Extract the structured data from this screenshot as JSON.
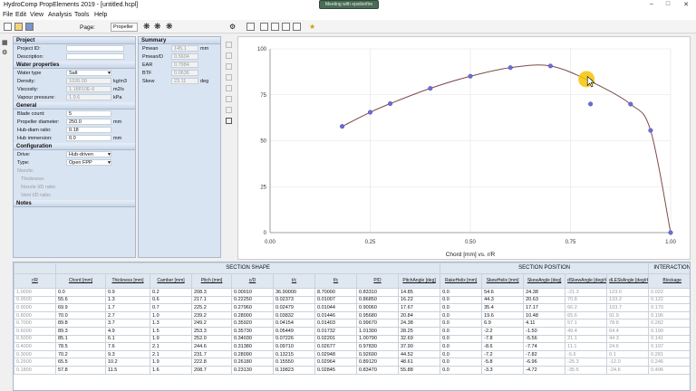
{
  "window": {
    "title": "HydroComp PropElements 2019 - [untitled.hcpl]",
    "notification": "Meeting with epsilonfire"
  },
  "menu": [
    "File",
    "Edit",
    "View",
    "Analysis",
    "Tools",
    "Help"
  ],
  "toolbar": {
    "page_label": "Page:",
    "page_value": "Propeller"
  },
  "project": {
    "heading": "Project",
    "fields": [
      {
        "label": "Project ID:",
        "value": ""
      },
      {
        "label": "Description:",
        "value": ""
      }
    ]
  },
  "water": {
    "heading": "Water properties",
    "fields": [
      {
        "label": "Water type",
        "value": "Salt",
        "unit": ""
      },
      {
        "label": "Density:",
        "value": "1026.00",
        "unit": "kg/m3"
      },
      {
        "label": "Viscosity:",
        "value": "1.18810E-6",
        "unit": "m2/s"
      },
      {
        "label": "Vapour pressure:",
        "value": "1.9.6",
        "unit": "kPa"
      }
    ]
  },
  "general": {
    "heading": "General",
    "fields": [
      {
        "label": "Blade count:",
        "value": "5",
        "unit": ""
      },
      {
        "label": "Propeller diameter:",
        "value": "250.0",
        "unit": "mm"
      },
      {
        "label": "Hub-diam ratio:",
        "value": "0.18",
        "unit": ""
      },
      {
        "label": "Hub immersion:",
        "value": "0.0",
        "unit": "mm"
      }
    ]
  },
  "configuration": {
    "heading": "Configuration",
    "fields": [
      {
        "label": "Drive:",
        "value": "Hub-driven"
      },
      {
        "label": "Type:",
        "value": "Open FPP"
      },
      {
        "label": "Nozzle:",
        "value": ""
      },
      {
        "label": "Thickness:",
        "value": ""
      },
      {
        "label": "Nozzle I/D ratio:",
        "value": ""
      },
      {
        "label": "Vent I/D ratio:",
        "value": ""
      }
    ]
  },
  "notes": {
    "heading": "Notes"
  },
  "summary": {
    "heading": "Summary",
    "fields": [
      {
        "label": "Pmean",
        "value": "145.1",
        "unit": "mm"
      },
      {
        "label": "Pmean/D",
        "value": "0.5604",
        "unit": ""
      },
      {
        "label": "EAR",
        "value": "0.7984",
        "unit": ""
      },
      {
        "label": "BTF",
        "value": "0.0636",
        "unit": ""
      },
      {
        "label": "Skew",
        "value": "23.11",
        "unit": "deg"
      }
    ]
  },
  "chart_data": {
    "type": "line",
    "xlabel": "Chord [mm] vs. r/R",
    "xlim": [
      0,
      1.0
    ],
    "ylim": [
      0,
      100
    ],
    "xticks": [
      "0.00",
      "0.25",
      "0.50",
      "0.75",
      "1.00"
    ],
    "yticks": [
      "0",
      "25",
      "50",
      "75",
      "100"
    ],
    "grid": true,
    "series": [
      {
        "values_x": [
          0.18,
          0.25,
          0.3,
          0.4,
          0.5,
          0.6,
          0.7,
          0.8,
          0.9,
          0.95,
          1.0
        ],
        "values_y": [
          57.8,
          65.5,
          70.2,
          78.5,
          85.1,
          89.8,
          90.7,
          82.3,
          69.9,
          55.6,
          0.0
        ]
      }
    ],
    "outlier_point": {
      "x": 0.8,
      "y": 70.0
    },
    "cursor_highlight": {
      "x": 0.79,
      "y": 83.5
    },
    "line_color": "#7b4a4a",
    "marker_color": "#6d6dd6",
    "highlight_color": "#f5c400"
  },
  "table": {
    "groups": [
      {
        "label": "",
        "span": 1
      },
      {
        "label": "SECTION SHAPE",
        "span": 9
      },
      {
        "label": "SECTION POSITION",
        "span": 5
      },
      {
        "label": "INTERACTION",
        "span": 1
      }
    ],
    "headers": [
      "r/R",
      "Chord [mm]",
      "Thickness [mm]",
      "Camber [mm]",
      "Pitch [mm]",
      "c/D",
      "t/c",
      "f/c",
      "P/D",
      "PitchAngle [deg]",
      "RakeHelix [mm]",
      "SkewHelix [mm]",
      "SkewAngle [deg]",
      "dSkewAngle [deg/rR]",
      "dLESkAngle [deg/rR]",
      "Blockage"
    ],
    "rows": [
      [
        "1.0000",
        "0.0",
        "0.9",
        "0.2",
        "208.3",
        "0.00010",
        "36.90000",
        "8.70000",
        "0.83310",
        "14.85",
        "0.0",
        "54.6",
        "24.38",
        "-21.3",
        "123.0",
        "0.022"
      ],
      [
        "0.9500",
        "55.6",
        "1.3",
        "0.6",
        "217.1",
        "0.22250",
        "0.02373",
        "0.01007",
        "0.86850",
        "16.22",
        "0.0",
        "44.3",
        "20.63",
        "70.8",
        "133.2",
        "0.122"
      ],
      [
        "0.9000",
        "69.9",
        "1.7",
        "0.7",
        "225.2",
        "0.27960",
        "0.02479",
        "0.01044",
        "0.90060",
        "17.67",
        "0.0",
        "35.4",
        "17.17",
        "66.2",
        "103.7",
        "0.170"
      ],
      [
        "0.8000",
        "70.0",
        "2.7",
        "1.0",
        "239.2",
        "0.28000",
        "0.03832",
        "0.01446",
        "0.95680",
        "20.84",
        "0.0",
        "19.6",
        "10.48",
        "65.6",
        "91.9",
        "0.196"
      ],
      [
        "0.7000",
        "89.8",
        "3.7",
        "1.3",
        "249.2",
        "0.35920",
        "0.04154",
        "0.01403",
        "0.99670",
        "24.38",
        "0.0",
        "6.9",
        "4.11",
        "57.1",
        "78.8",
        "0.282"
      ],
      [
        "0.6000",
        "89.3",
        "4.9",
        "1.5",
        "253.3",
        "0.35730",
        "0.05449",
        "0.01732",
        "1.01300",
        "28.25",
        "0.0",
        "-2.2",
        "-1.50",
        "49.4",
        "64.4",
        "0.199"
      ],
      [
        "0.5000",
        "85.1",
        "6.1",
        "1.9",
        "252.0",
        "0.34030",
        "0.07226",
        "0.02201",
        "1.00790",
        "32.69",
        "0.0",
        "-7.8",
        "-5.56",
        "21.1",
        "44.3",
        "0.141"
      ],
      [
        "0.4000",
        "78.5",
        "7.6",
        "2.1",
        "244.6",
        "0.31380",
        "0.09710",
        "0.02677",
        "0.97830",
        "37.90",
        "0.0",
        "-8.6",
        "-7.74",
        "11.1",
        "24.6",
        "0.197"
      ],
      [
        "0.3000",
        "70.2",
        "9.3",
        "2.1",
        "231.7",
        "0.28090",
        "0.13215",
        "0.02948",
        "0.92690",
        "44.52",
        "0.0",
        "-7.2",
        "-7.82",
        "-5.6",
        "0.1",
        "0.281"
      ],
      [
        "0.2500",
        "65.5",
        "10.2",
        "1.9",
        "222.8",
        "0.26180",
        "0.15550",
        "0.02964",
        "0.89120",
        "48.61",
        "0.0",
        "-5.8",
        "-6.96",
        "-25.3",
        "-12.0",
        "0.246"
      ],
      [
        "0.1800",
        "57.8",
        "11.5",
        "1.6",
        "208.7",
        "0.23130",
        "0.19823",
        "0.02845",
        "0.83470",
        "55.88",
        "0.0",
        "-3.3",
        "-4.72",
        "-35.5",
        "-24.6",
        "0.496"
      ]
    ]
  }
}
